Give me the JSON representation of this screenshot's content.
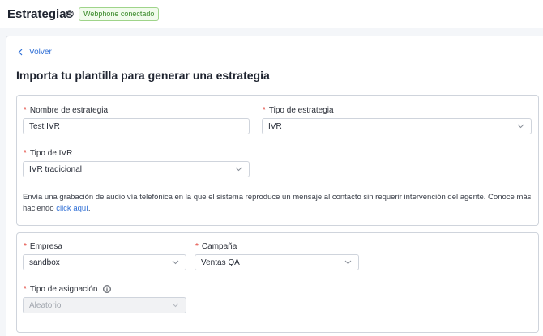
{
  "header": {
    "title": "Estrategias",
    "status_badge": "Webphone conectado"
  },
  "nav": {
    "back_label": "Volver"
  },
  "page": {
    "heading": "Importa tu plantilla para generar una estrategia"
  },
  "strategy_section": {
    "name_label": "Nombre de estrategia",
    "name_value": "Test IVR",
    "type_label": "Tipo de estrategia",
    "type_value": "IVR",
    "ivr_type_label": "Tipo de IVR",
    "ivr_type_value": "IVR tradicional",
    "description_text": "Envía una grabación de audio vía telefónica en la que el sistema reproduce un mensaje al contacto sin requerir intervención del agente. Conoce más haciendo ",
    "description_link": "click aquí",
    "description_end": "."
  },
  "company_section": {
    "company_label": "Empresa",
    "company_value": "sandbox",
    "campaign_label": "Campaña",
    "campaign_value": "Ventas QA",
    "assignment_label": "Tipo de asignación",
    "assignment_value": "Aleatorio"
  },
  "required_marker": "*",
  "colors": {
    "accent": "#2f6fd6",
    "required": "#e0352b",
    "badge_text": "#3a8a2a",
    "badge_border": "#9fd48a"
  }
}
